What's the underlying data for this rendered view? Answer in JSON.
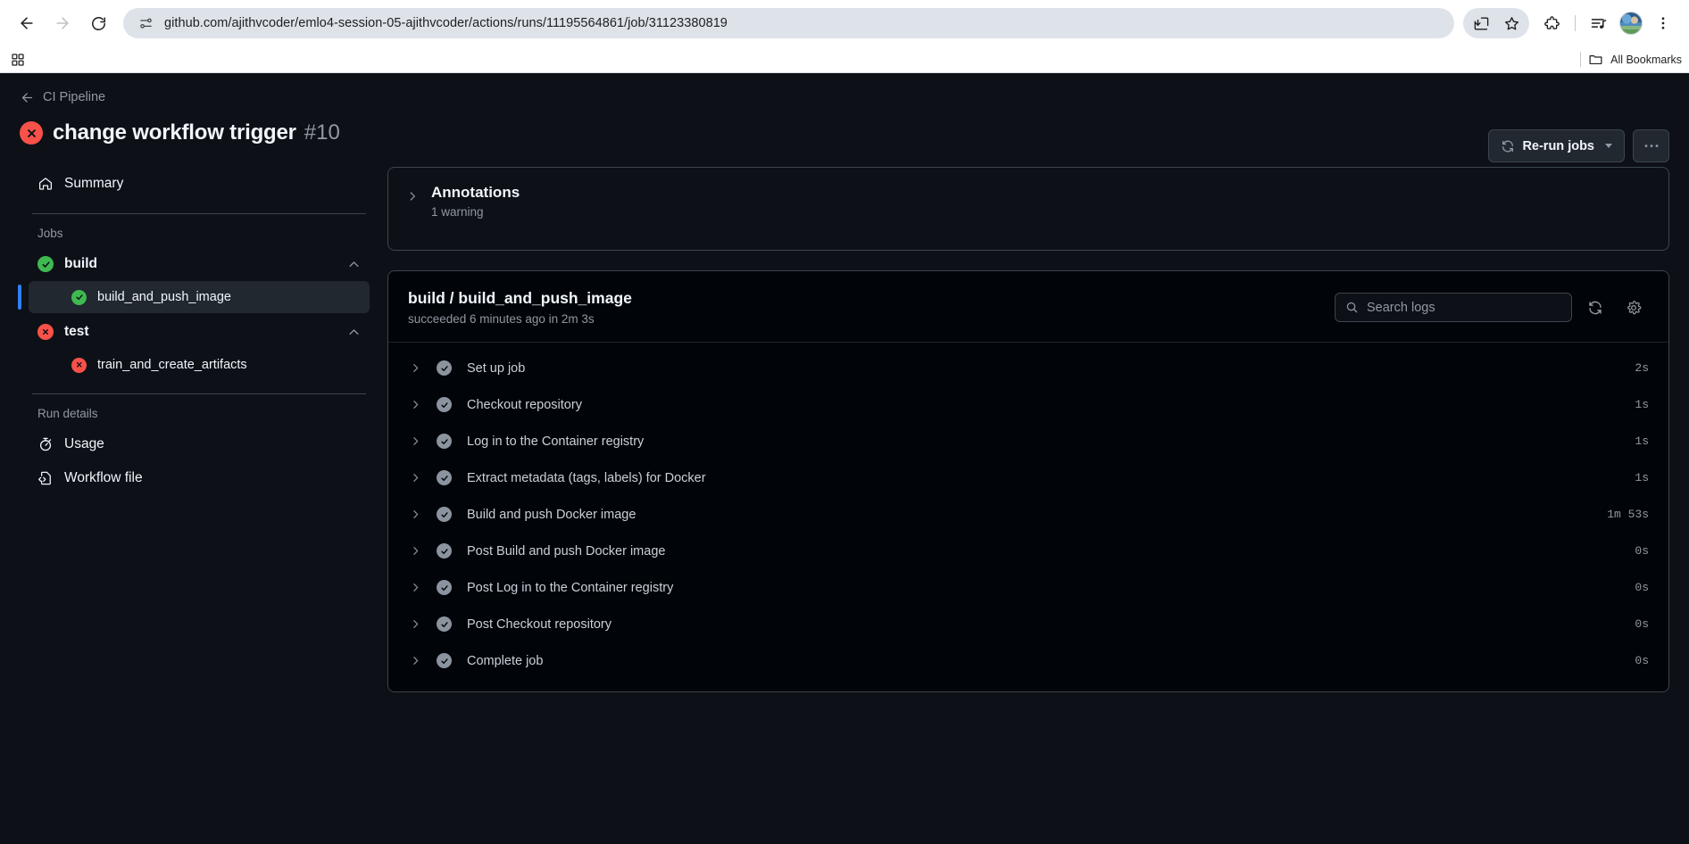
{
  "browser": {
    "url": "github.com/ajithvcoder/emlo4-session-05-ajithvcoder/actions/runs/11195564861/job/31123380819",
    "back_icon": "back-arrow-icon",
    "forward_icon": "forward-arrow-icon",
    "reload_icon": "reload-icon",
    "site_info_icon": "site-settings-icon",
    "install_icon": "install-app-icon",
    "bookmark_icon": "star-icon",
    "extensions_icon": "puzzle-piece-icon",
    "media_icon": "media-playlist-icon",
    "profile_icon": "profile-avatar",
    "menu_icon": "three-dot-menu-icon",
    "apps_icon": "apps-grid-icon",
    "all_bookmarks_label": "All Bookmarks",
    "all_bookmarks_icon": "folder-icon"
  },
  "header": {
    "back_icon": "back-arrow-icon",
    "breadcrumb": "CI Pipeline",
    "status_icon": "failure-x-icon",
    "title": "change workflow trigger",
    "run_number": "#10",
    "rerun_label": "Re-run jobs",
    "rerun_icon": "sync-refresh-icon",
    "rerun_caret_icon": "chevron-down-icon",
    "more_label": "•••",
    "more_icon": "kebab-menu-icon"
  },
  "sidebar": {
    "summary": {
      "label": "Summary",
      "icon": "home-icon"
    },
    "jobs_heading": "Jobs",
    "jobs": [
      {
        "name": "build",
        "status": "success",
        "icon": "check-circle-icon",
        "collapse_icon": "chevron-up-icon",
        "children": [
          {
            "name": "build_and_push_image",
            "status": "success",
            "icon": "check-circle-icon",
            "selected": true
          }
        ]
      },
      {
        "name": "test",
        "status": "failure",
        "icon": "x-circle-icon",
        "collapse_icon": "chevron-up-icon",
        "children": [
          {
            "name": "train_and_create_artifacts",
            "status": "failure",
            "icon": "x-circle-icon",
            "selected": false
          }
        ]
      }
    ],
    "run_details_heading": "Run details",
    "run_details": [
      {
        "label": "Usage",
        "icon": "stopwatch-icon"
      },
      {
        "label": "Workflow file",
        "icon": "code-file-icon"
      }
    ]
  },
  "annotations": {
    "expand_icon": "chevron-right-icon",
    "title": "Annotations",
    "subtitle": "1 warning"
  },
  "logs": {
    "job_name": "build / build_and_push_image",
    "job_meta": "succeeded 6 minutes ago in 2m 3s",
    "search_placeholder": "Search logs",
    "search_value": "",
    "search_icon": "search-icon",
    "refresh_icon": "sync-refresh-icon",
    "settings_icon": "gear-icon",
    "steps": [
      {
        "label": "Set up job",
        "duration": "2s",
        "status": "success"
      },
      {
        "label": "Checkout repository",
        "duration": "1s",
        "status": "success"
      },
      {
        "label": "Log in to the Container registry",
        "duration": "1s",
        "status": "success"
      },
      {
        "label": "Extract metadata (tags, labels) for Docker",
        "duration": "1s",
        "status": "success"
      },
      {
        "label": "Build and push Docker image",
        "duration": "1m 53s",
        "status": "success"
      },
      {
        "label": "Post Build and push Docker image",
        "duration": "0s",
        "status": "success"
      },
      {
        "label": "Post Log in to the Container registry",
        "duration": "0s",
        "status": "success"
      },
      {
        "label": "Post Checkout repository",
        "duration": "0s",
        "status": "success"
      },
      {
        "label": "Complete job",
        "duration": "0s",
        "status": "success"
      }
    ]
  },
  "colors": {
    "page_bg": "#0d1117",
    "panel_bg": "#010409",
    "border": "#3d444d",
    "accent_blue": "#2f81f7",
    "success_green": "#3fb950",
    "failure_red": "#f85149",
    "muted_text": "#9198a1"
  }
}
